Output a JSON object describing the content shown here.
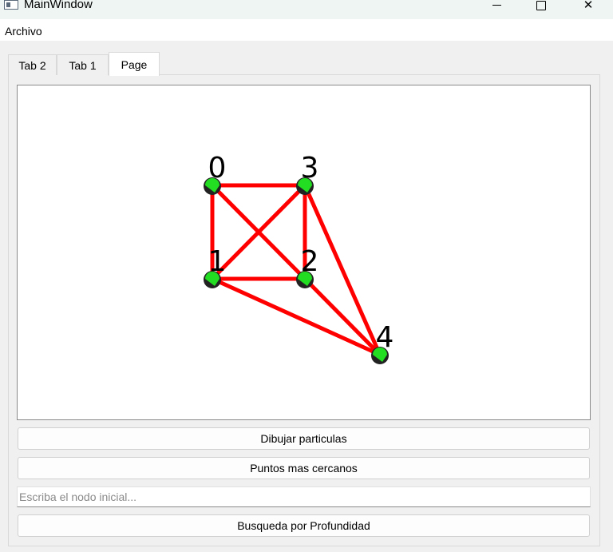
{
  "window": {
    "title": "MainWindow",
    "minimize_icon": "minimize-icon",
    "maximize_icon": "maximize-icon",
    "close_glyph": "✕"
  },
  "menubar": {
    "items": [
      "Archivo"
    ]
  },
  "tabs": [
    {
      "label": "Tab 2",
      "active": false
    },
    {
      "label": "Tab 1",
      "active": false
    },
    {
      "label": "Page",
      "active": true
    }
  ],
  "graph": {
    "nodes": [
      {
        "label": "0"
      },
      {
        "label": "3"
      },
      {
        "label": "1"
      },
      {
        "label": "2"
      },
      {
        "label": "4"
      }
    ],
    "edge_color": "#ff0000",
    "node_fill": "#22dd22",
    "node_shadow": "#222222",
    "label_color": "#000000"
  },
  "buttons": {
    "dibujar": "Dibujar particulas",
    "cercanos": "Puntos mas cercanos",
    "profundidad": "Busqueda por Profundidad"
  },
  "nodo_input": {
    "placeholder": "Escriba el nodo inicial...",
    "value": ""
  }
}
